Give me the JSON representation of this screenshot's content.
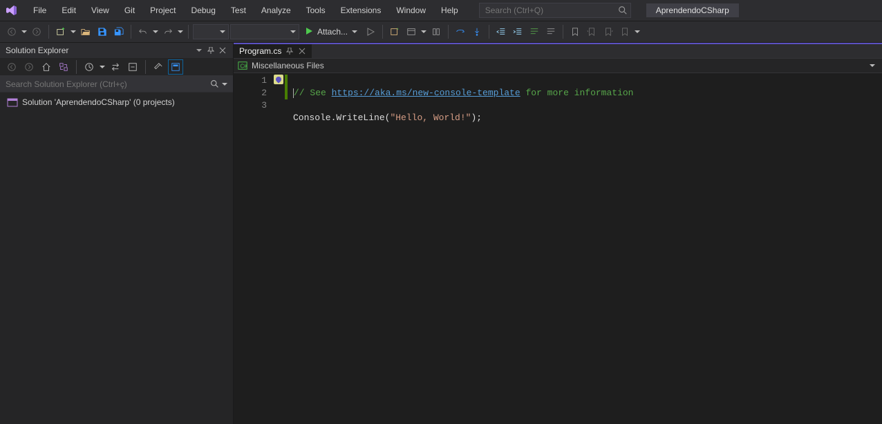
{
  "menu": {
    "items": [
      "File",
      "Edit",
      "View",
      "Git",
      "Project",
      "Debug",
      "Test",
      "Analyze",
      "Tools",
      "Extensions",
      "Window",
      "Help"
    ]
  },
  "search": {
    "placeholder": "Search (Ctrl+Q)"
  },
  "solution_name": "AprendendoCSharp",
  "toolbar": {
    "attach_label": "Attach..."
  },
  "solution_explorer": {
    "title": "Solution Explorer",
    "search_placeholder": "Search Solution Explorer (Ctrl+ç)",
    "root_label": "Solution 'AprendendoCSharp' (0 projects)"
  },
  "editor": {
    "tab_label": "Program.cs",
    "nav_scope": "Miscellaneous Files",
    "code_lines": {
      "l1_pre": "// See ",
      "l1_link": "https://aka.ms/new-console-template",
      "l1_post": " for more information",
      "l2_a": "Console.WriteLine(",
      "l2_str": "\"Hello, World!\"",
      "l2_b": ");"
    },
    "line_numbers": [
      "1",
      "2",
      "3"
    ]
  }
}
